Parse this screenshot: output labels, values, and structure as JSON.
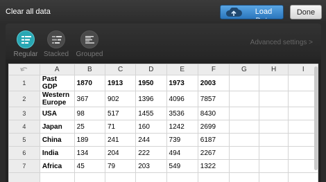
{
  "header": {
    "clear_label": "Clear all data",
    "load_label": "Load Data",
    "done_label": "Done"
  },
  "chart_types": [
    {
      "label": "Regular",
      "icon": "regular-chart-icon",
      "active": true
    },
    {
      "label": "Stacked",
      "icon": "stacked-chart-icon",
      "active": false
    },
    {
      "label": "Grouped",
      "icon": "grouped-chart-icon",
      "active": false
    }
  ],
  "advanced_label": "Advanced settings >",
  "colors": {
    "accent": "#29a7b3",
    "load_button": "#3b8fd6",
    "background": "#2b2b2b"
  },
  "sheet": {
    "columns": [
      "A",
      "B",
      "C",
      "D",
      "E",
      "F",
      "G",
      "H",
      "I"
    ],
    "rows": [
      {
        "num": "1",
        "cells": [
          "Past GDP",
          "1870",
          "1913",
          "1950",
          "1973",
          "2003",
          "",
          "",
          ""
        ]
      },
      {
        "num": "2",
        "cells": [
          "Western Europe",
          "367",
          "902",
          "1396",
          "4096",
          "7857",
          "",
          "",
          ""
        ]
      },
      {
        "num": "3",
        "cells": [
          "USA",
          "98",
          "517",
          "1455",
          "3536",
          "8430",
          "",
          "",
          ""
        ]
      },
      {
        "num": "4",
        "cells": [
          "Japan",
          "25",
          "71",
          "160",
          "1242",
          "2699",
          "",
          "",
          ""
        ]
      },
      {
        "num": "5",
        "cells": [
          "China",
          "189",
          "241",
          "244",
          "739",
          "6187",
          "",
          "",
          ""
        ]
      },
      {
        "num": "6",
        "cells": [
          "India",
          "134",
          "204",
          "222",
          "494",
          "2267",
          "",
          "",
          ""
        ]
      },
      {
        "num": "7",
        "cells": [
          "Africa",
          "45",
          "79",
          "203",
          "549",
          "1322",
          "",
          "",
          ""
        ]
      },
      {
        "num": "",
        "cells": [
          "",
          "",
          "",
          "",
          "",
          "",
          "",
          "",
          ""
        ]
      }
    ]
  }
}
